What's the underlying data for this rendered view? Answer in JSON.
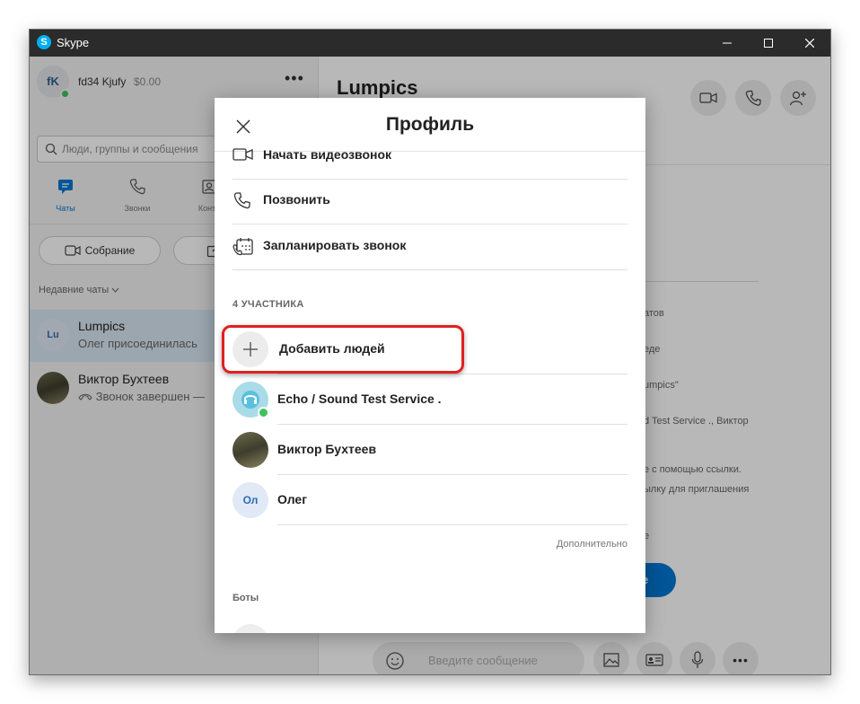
{
  "window": {
    "title": "Skype"
  },
  "left": {
    "me_initials": "fK",
    "me_name": "fd34 Kjufy",
    "me_balance": "$0.00",
    "search_placeholder": "Люди, группы и сообщения",
    "tabs": [
      {
        "label": "Чаты",
        "icon": "chat-icon"
      },
      {
        "label": "Звонки",
        "icon": "phone-icon"
      },
      {
        "label": "Конта",
        "icon": "contacts-icon"
      }
    ],
    "meet_label": "Собрание",
    "recent_label": "Недавние чаты",
    "chats": [
      {
        "initials": "Lu",
        "name": "Lumpics",
        "sub": "Олег присоединилась"
      },
      {
        "name": "Виктор Бухтеев",
        "sub": "Звонок завершен —"
      }
    ]
  },
  "main": {
    "title": "Lumpics",
    "bg_fragments": [
      "атов",
      "еде",
      "umpics\"",
      "d Test Service ., Виктор",
      "е с помощью ссылки.",
      "ылку для приглашения",
      "е"
    ],
    "share_pill": "е",
    "compose_placeholder": "Введите сообщение"
  },
  "modal": {
    "title": "Профиль",
    "actions": [
      {
        "label": "Начать видеозвонок",
        "icon": "video-icon"
      },
      {
        "label": "Позвонить",
        "icon": "phone-icon"
      },
      {
        "label": "Запланировать звонок",
        "icon": "calendar-phone-icon"
      }
    ],
    "participants_header": "4 УЧАСТНИКА",
    "add_people": "Добавить людей",
    "participants": [
      {
        "name": "Echo / Sound Test Service .",
        "online": true
      },
      {
        "name": "Виктор Бухтеев"
      },
      {
        "initials": "Ол",
        "name": "Олег"
      }
    ],
    "more_link": "Дополнительно",
    "bots_header": "Боты"
  },
  "colors": {
    "accent": "#0078d4",
    "online": "#3fc15b",
    "highlight": "#e02020"
  }
}
